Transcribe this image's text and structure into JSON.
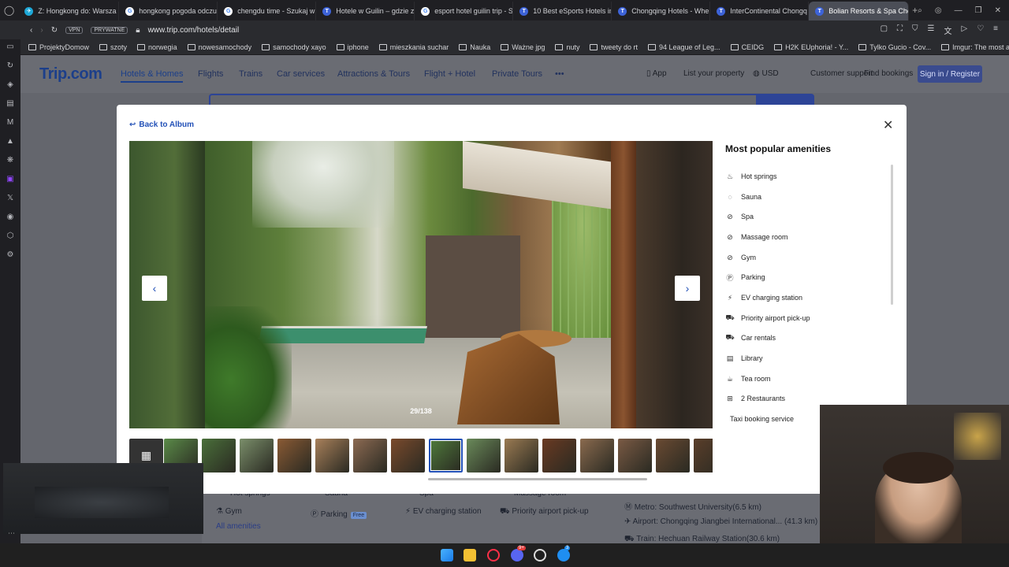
{
  "browser": {
    "tabs": [
      {
        "label": "Z: Hongkong do: Warsza",
        "fav_color": "#1ea8d8",
        "fav_char": "✈"
      },
      {
        "label": "hongkong pogoda odczu",
        "fav_color": "#ffffff",
        "fav_char": "G"
      },
      {
        "label": "chengdu time - Szukaj w",
        "fav_color": "#ffffff",
        "fav_char": "G"
      },
      {
        "label": "Hotele w Guilin – gdzie z",
        "fav_color": "#3d63d8",
        "fav_char": "T"
      },
      {
        "label": "esport hotel guilin trip - S",
        "fav_color": "#ffffff",
        "fav_char": "G"
      },
      {
        "label": "10 Best eSports Hotels in",
        "fav_color": "#3d63d8",
        "fav_char": "T"
      },
      {
        "label": "Chongqing Hotels - Whe",
        "fav_color": "#3d63d8",
        "fav_char": "T"
      },
      {
        "label": "InterContinental Chongq",
        "fav_color": "#3d63d8",
        "fav_char": "T"
      },
      {
        "label": "Bolian Resorts & Spa Chc",
        "fav_color": "#3d63d8",
        "fav_char": "T",
        "active": true
      }
    ],
    "url": "www.trip.com/hotels/detail",
    "vpn_label": "VPN",
    "private_label": "PRYWATNE",
    "bookmarks": [
      "ProjektyDomow",
      "szoty",
      "norwegia",
      "nowesamochody",
      "samochody xayo",
      "iphone",
      "mieszkania suchar",
      "Nauka",
      "Ważne jpg",
      "nuty",
      "tweety do rt",
      "94 League of Leg...",
      "CEIDG",
      "H2K EUphoria! - Y...",
      "Tylko Gucio - Cov...",
      "Imgur: The most a..."
    ]
  },
  "site": {
    "logo": "Trip.com",
    "nav": [
      "Hotels & Homes",
      "Flights",
      "Trains",
      "Car services",
      "Attractions & Tours",
      "Flight + Hotel",
      "Private Tours",
      "•••"
    ],
    "right": {
      "app": "App",
      "list": "List your property",
      "currency": "USD",
      "support": "Customer support",
      "bookings": "Find bookings",
      "signin": "Sign in / Register"
    },
    "bg_amenities": {
      "hot_springs": "Hot springs",
      "sauna": "Sauna",
      "spa": "Spa",
      "massage": "Massage room",
      "gym": "Gym",
      "parking": "Parking",
      "free": "Free",
      "ev": "EV charging station",
      "pickup": "Priority airport pick-up",
      "all": "All amenities"
    },
    "transport": [
      "Metro: Southwest University(6.5 km)",
      "Airport: Chongqing Jiangbei International... (41.3 km)",
      "Train: Hechuan Railway Station(30.6 km)"
    ]
  },
  "modal": {
    "back_label": "Back to Album",
    "counter": "29/138",
    "amenities_title": "Most popular amenities",
    "amenities": [
      {
        "label": "Hot springs",
        "icon": "hot-springs-icon",
        "glyph": "♨"
      },
      {
        "label": "Sauna",
        "icon": "sauna-icon",
        "glyph": "◌"
      },
      {
        "label": "Spa",
        "icon": "spa-icon",
        "glyph": "⊘"
      },
      {
        "label": "Massage room",
        "icon": "massage-icon",
        "glyph": "⊘"
      },
      {
        "label": "Gym",
        "icon": "gym-icon",
        "glyph": "⊘"
      },
      {
        "label": "Parking",
        "icon": "parking-icon",
        "glyph": "Ⓟ"
      },
      {
        "label": "EV charging station",
        "icon": "ev-charging-icon",
        "glyph": "⚡"
      },
      {
        "label": "Priority airport pick-up",
        "icon": "car-icon",
        "glyph": "⛟"
      },
      {
        "label": "Car rentals",
        "icon": "car-icon",
        "glyph": "⛟"
      },
      {
        "label": "Library",
        "icon": "library-icon",
        "glyph": "▤"
      },
      {
        "label": "Tea room",
        "icon": "tea-icon",
        "glyph": "☕"
      },
      {
        "label": "2 Restaurants",
        "icon": "restaurant-icon",
        "glyph": "⊞"
      },
      {
        "label": "Taxi booking service",
        "icon": "",
        "glyph": ""
      }
    ],
    "thumbnail_colors": [
      "#5a8a48",
      "#4a6f3a",
      "#7a8e6a",
      "#8a5a34",
      "#a8805a",
      "#8c6a52",
      "#7a4a2c",
      "#4f7a3c",
      "#6a8a5a",
      "#9a7a52",
      "#6a3a22",
      "#8a6a4e",
      "#7a5a44",
      "#6a4a32",
      "#5a3e2a"
    ]
  },
  "taskbar": {
    "discord_badge": "9+",
    "messenger_badge": "3"
  }
}
